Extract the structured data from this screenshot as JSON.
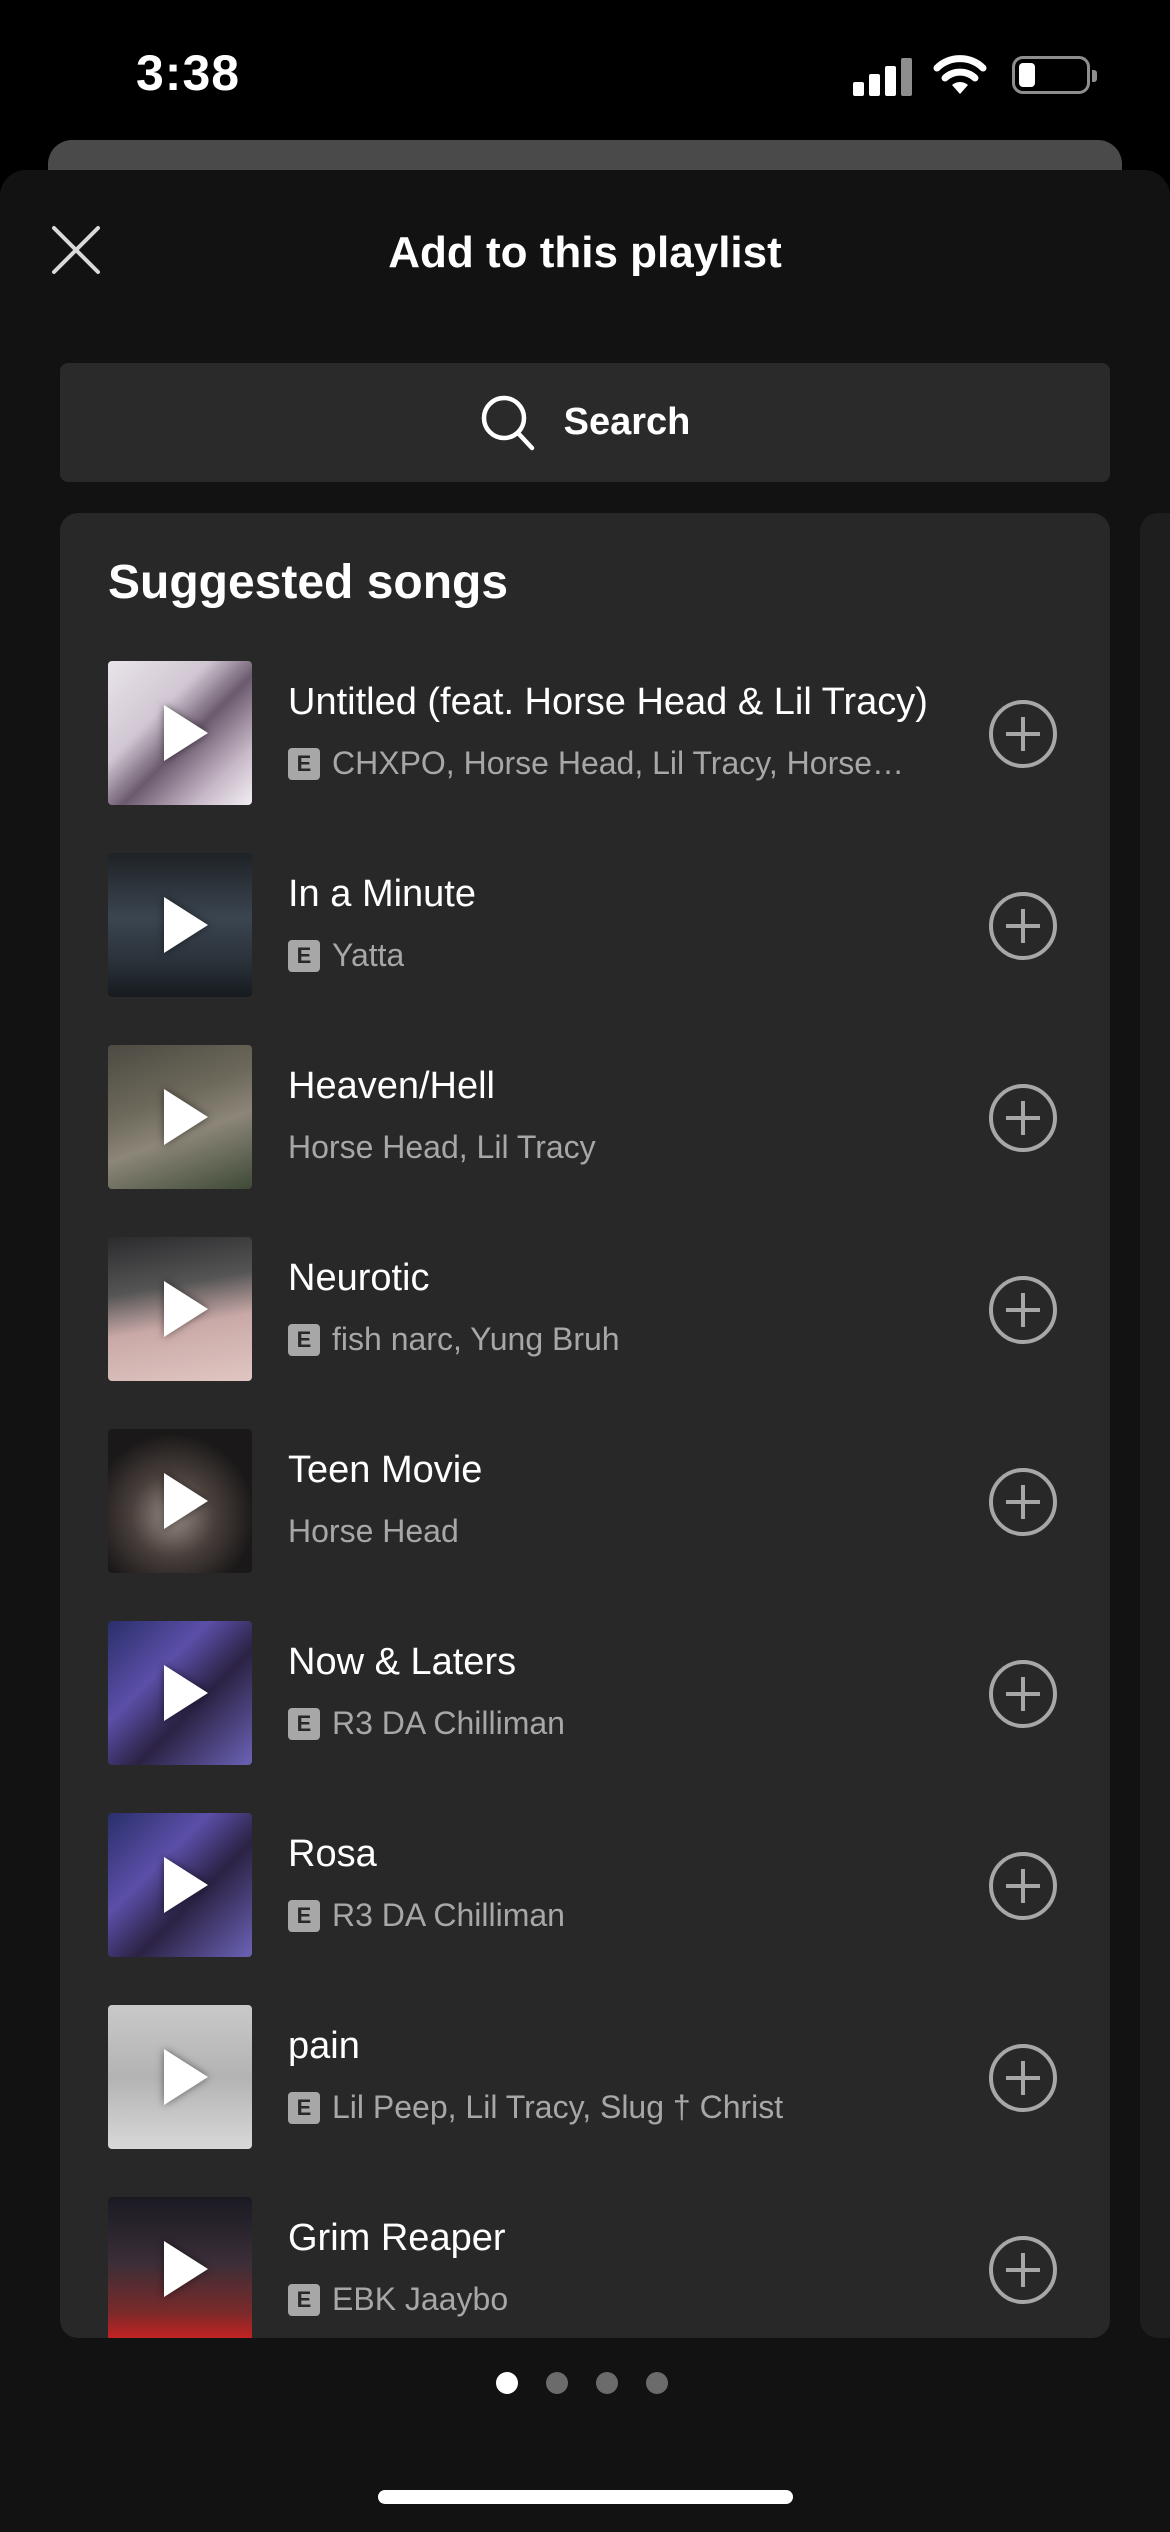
{
  "status_bar": {
    "time": "3:38"
  },
  "header": {
    "title": "Add to this playlist"
  },
  "search": {
    "label": "Search"
  },
  "suggested": {
    "title": "Suggested songs",
    "songs": [
      {
        "title": "Untitled (feat. Horse Head & Lil Tracy)",
        "artists": "CHXPO, Horse Head, Lil Tracy, Horse…",
        "explicit": "E"
      },
      {
        "title": "In a Minute",
        "artists": "Yatta",
        "explicit": "E"
      },
      {
        "title": "Heaven/Hell",
        "artists": "Horse Head, Lil Tracy"
      },
      {
        "title": "Neurotic",
        "artists": "fish narc, Yung Bruh",
        "explicit": "E"
      },
      {
        "title": "Teen Movie",
        "artists": "Horse Head"
      },
      {
        "title": "Now & Laters",
        "artists": "R3 DA Chilliman",
        "explicit": "E"
      },
      {
        "title": "Rosa",
        "artists": "R3 DA Chilliman",
        "explicit": "E"
      },
      {
        "title": "pain",
        "artists": "Lil Peep, Lil Tracy, Slug † Christ",
        "explicit": "E"
      },
      {
        "title": "Grim Reaper",
        "artists": "EBK Jaaybo",
        "explicit": "E"
      }
    ]
  },
  "pager": {
    "pages": 4,
    "active_page": 1
  },
  "colors": {
    "background": "#121212",
    "card": "#282828",
    "secondary_text": "#a7a7a7"
  }
}
